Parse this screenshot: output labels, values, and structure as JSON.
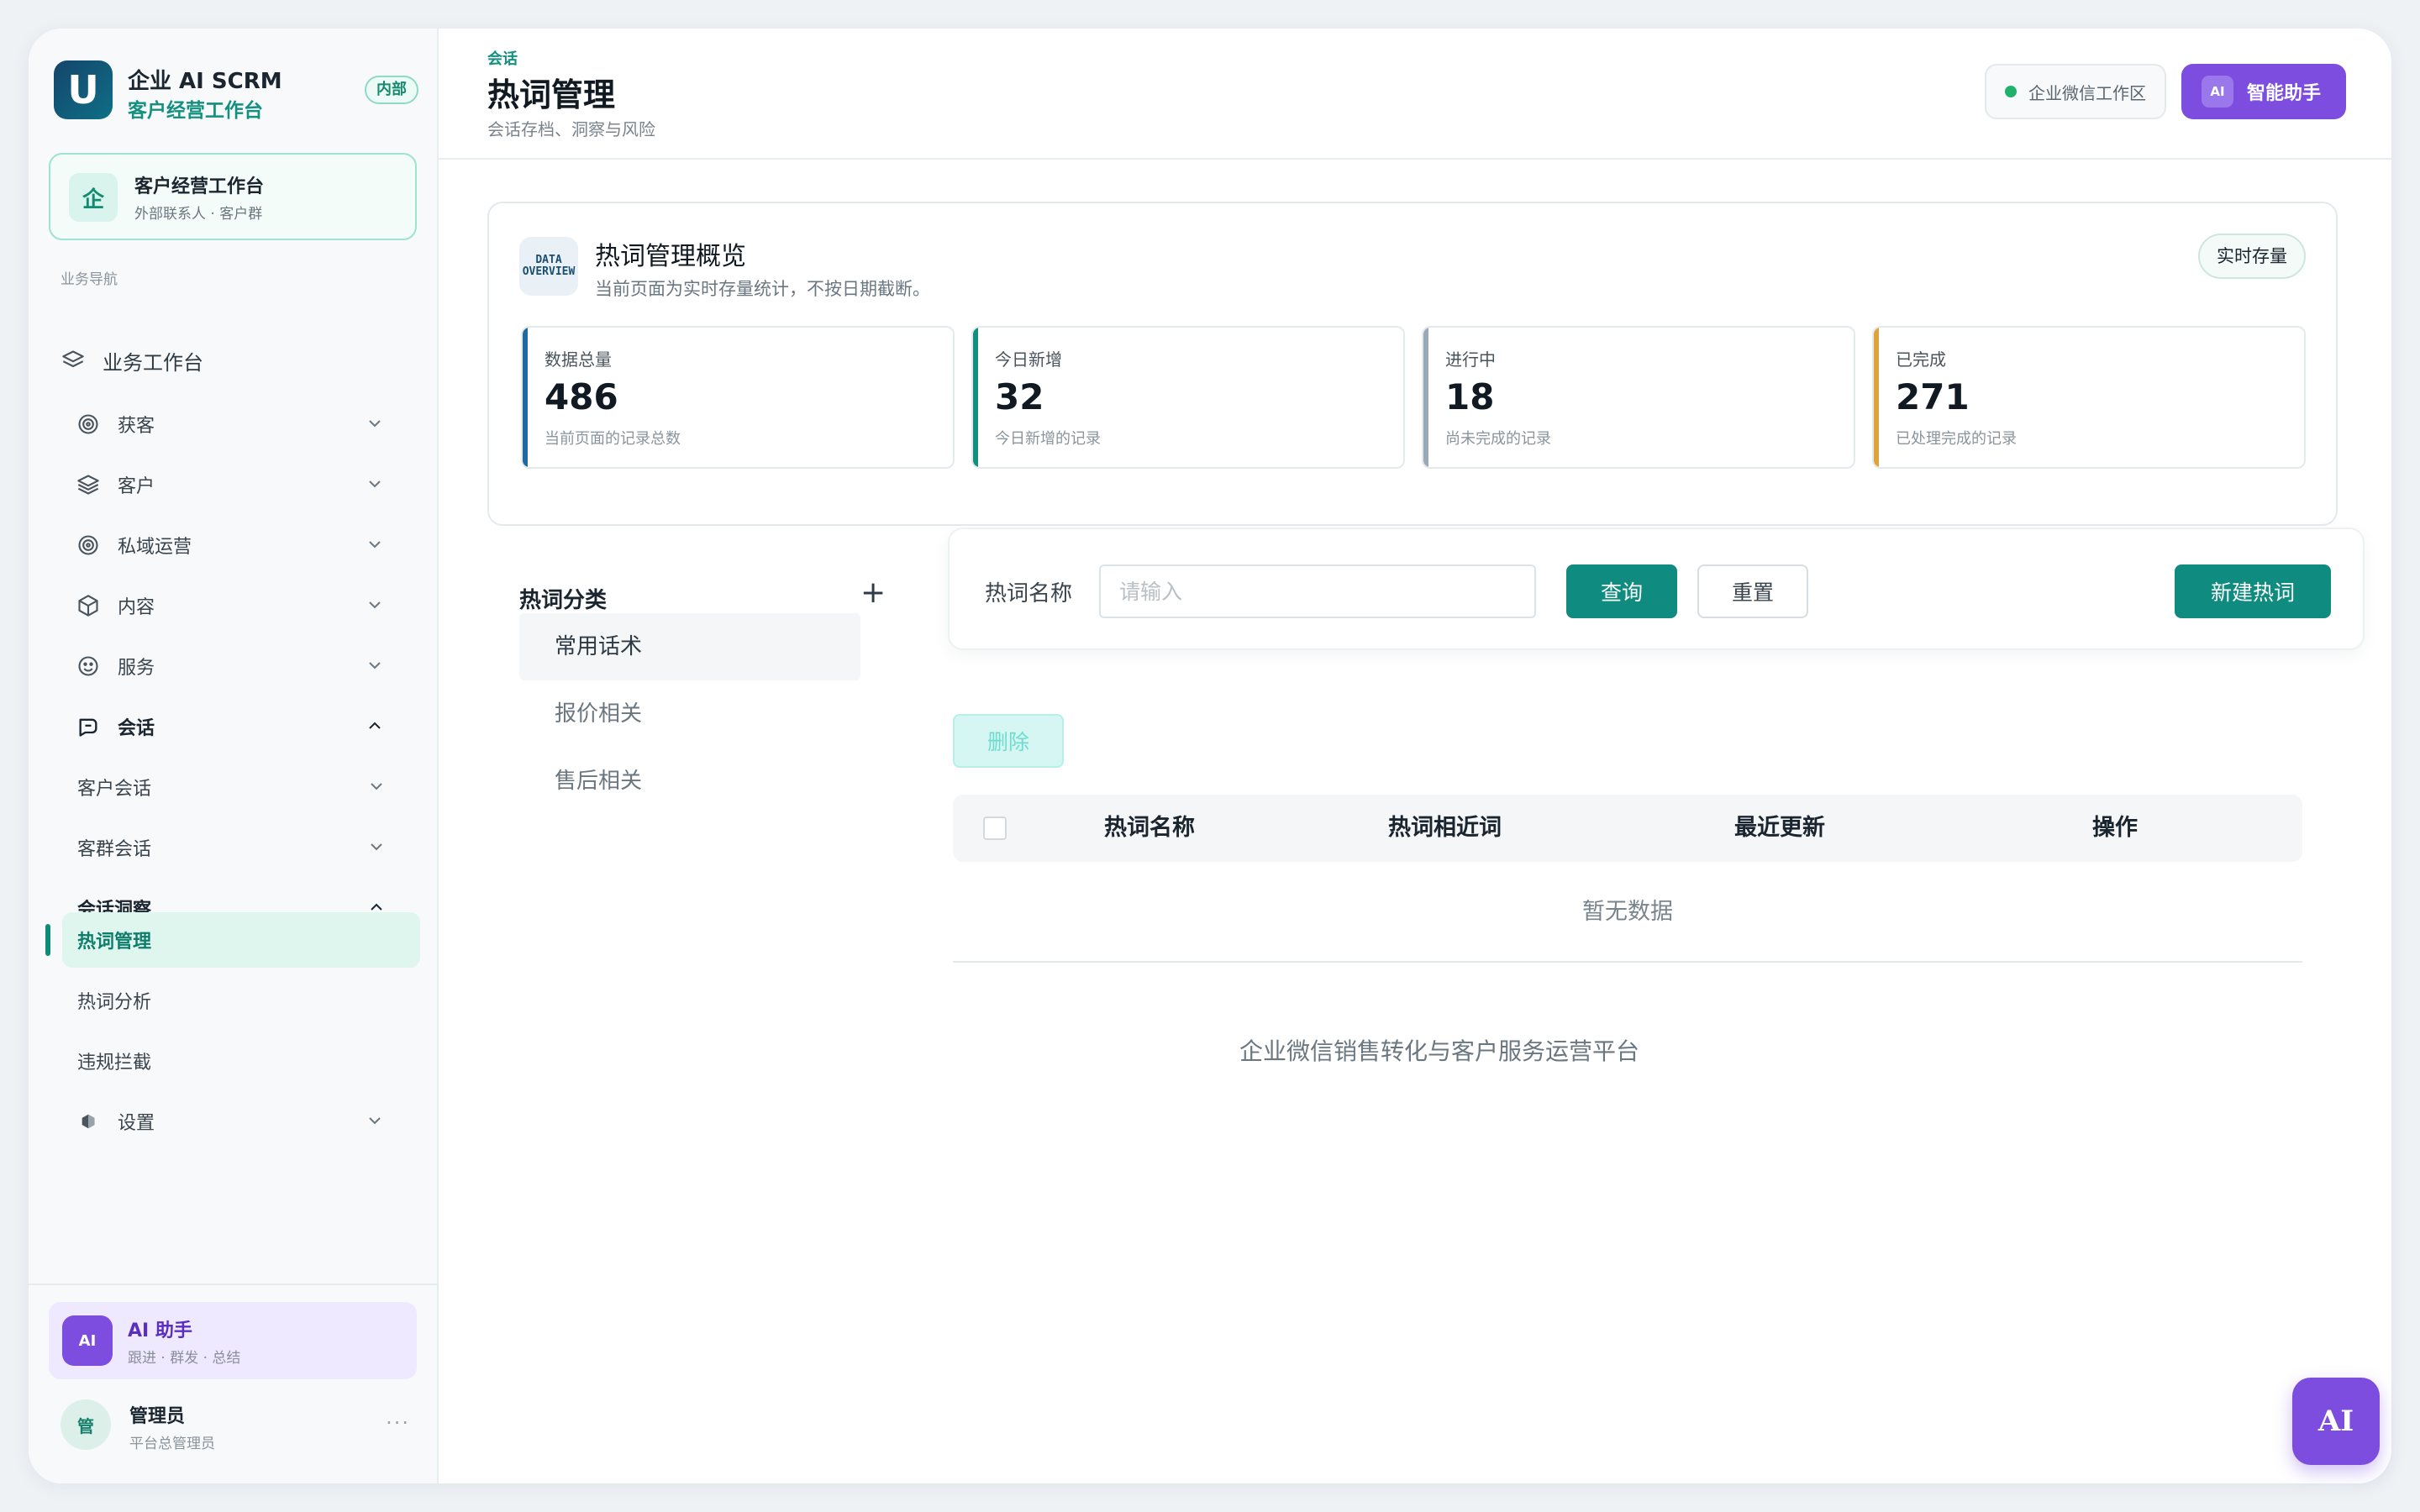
{
  "brand": {
    "logo": "U",
    "title": "企业 AI SCRM",
    "subtitle": "客户经营工作台",
    "tag": "内部"
  },
  "workspace": {
    "icon": "企",
    "title": "客户经营工作台",
    "subtitle": "外部联系人 · 客户群"
  },
  "sidebar": {
    "section": "业务导航",
    "items": [
      {
        "label": "业务工作台",
        "icon": "layers-icon"
      },
      {
        "label": "获客",
        "icon": "target-icon"
      },
      {
        "label": "客户",
        "icon": "layers-icon"
      },
      {
        "label": "私域运营",
        "icon": "target-icon"
      },
      {
        "label": "内容",
        "icon": "box-icon"
      },
      {
        "label": "服务",
        "icon": "smile-icon"
      },
      {
        "label": "会话",
        "icon": "chat-icon"
      },
      {
        "label": "客户会话"
      },
      {
        "label": "客群会话"
      },
      {
        "label": "会话洞察"
      },
      {
        "label": "热词管理"
      },
      {
        "label": "热词分析"
      },
      {
        "label": "违规拦截"
      },
      {
        "label": "设置",
        "icon": "settings-icon"
      }
    ]
  },
  "ai_card": {
    "badge": "AI",
    "title": "AI 助手",
    "subtitle": "跟进 · 群发 · 总结"
  },
  "admin": {
    "avatar": "管",
    "name": "管理员",
    "role": "平台总管理员",
    "more": "···"
  },
  "header": {
    "breadcrumb": "会话",
    "title": "热词管理",
    "description": "会话存档、洞察与风险",
    "workspace_chip": "企业微信工作区",
    "assistant_badge": "AI",
    "assistant_label": "智能助手"
  },
  "overview": {
    "icon_line1": "DATA",
    "icon_line2": "OVERVIEW",
    "title": "热词管理概览",
    "description": "当前页面为实时存量统计，不按日期截断。",
    "tag": "实时存量",
    "stats": [
      {
        "label": "数据总量",
        "value": "486",
        "note": "当前页面的记录总数",
        "color": "#1f6aa0"
      },
      {
        "label": "今日新增",
        "value": "32",
        "note": "今日新增的记录",
        "color": "#12907d"
      },
      {
        "label": "进行中",
        "value": "18",
        "note": "尚未完成的记录",
        "color": "#9aa9b8"
      },
      {
        "label": "已完成",
        "value": "271",
        "note": "已处理完成的记录",
        "color": "#e0a23a"
      }
    ]
  },
  "categories": {
    "title": "热词分类",
    "add": "+",
    "items": [
      "常用话术",
      "报价相关",
      "售后相关"
    ]
  },
  "search": {
    "label": "热词名称",
    "placeholder": "请输入",
    "value": "",
    "query": "查询",
    "reset": "重置",
    "new": "新建热词"
  },
  "table": {
    "delete": "删除",
    "columns": [
      "热词名称",
      "热词相近词",
      "最近更新",
      "操作"
    ],
    "empty": "暂无数据"
  },
  "footer": "企业微信销售转化与客户服务运营平台",
  "float_ai": "AI"
}
